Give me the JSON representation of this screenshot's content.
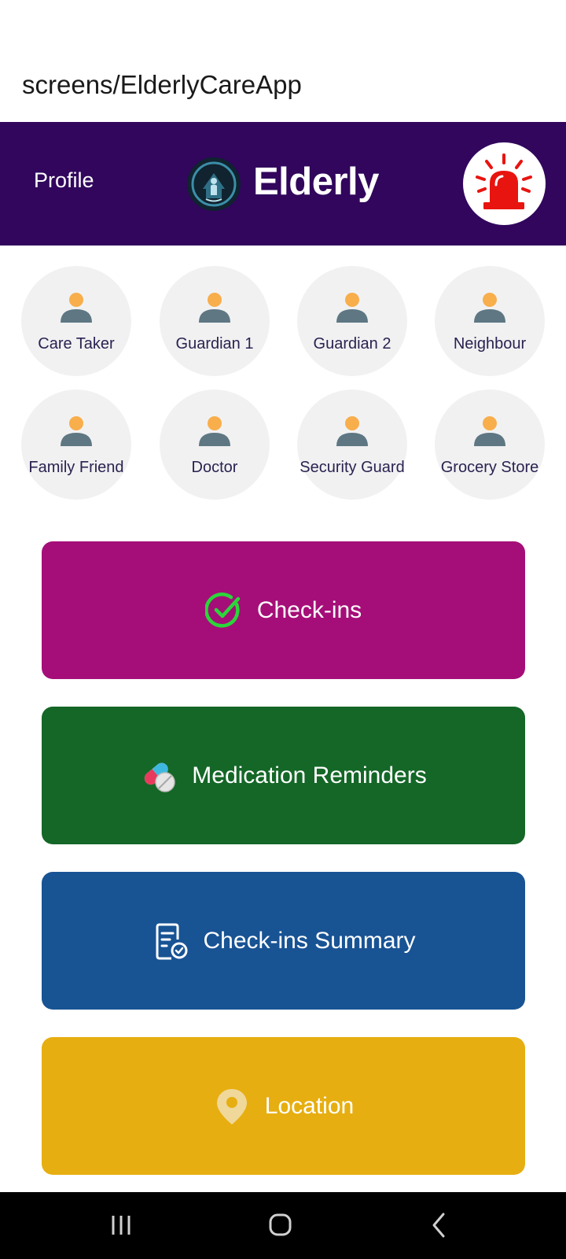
{
  "route_title": "screens/ElderlyCareApp",
  "header": {
    "profile_label": "Profile",
    "brand_title": "Elderly",
    "logo_icon": "elderly-logo-icon",
    "alarm_icon": "siren-alarm-icon",
    "background": "#31065c"
  },
  "contacts": [
    {
      "label": "Care Taker"
    },
    {
      "label": "Guardian 1"
    },
    {
      "label": "Guardian 2"
    },
    {
      "label": "Neighbour"
    },
    {
      "label": "Family Friend"
    },
    {
      "label": "Doctor"
    },
    {
      "label": "Security Guard"
    },
    {
      "label": "Grocery Store"
    }
  ],
  "actions": [
    {
      "label": "Check-ins",
      "icon": "check-circle-icon",
      "color": "#a50e78"
    },
    {
      "label": "Medication Reminders",
      "icon": "pills-icon",
      "color": "#146727"
    },
    {
      "label": "Check-ins Summary",
      "icon": "document-check-icon",
      "color": "#185394"
    },
    {
      "label": "Location",
      "icon": "map-pin-icon",
      "color": "#e6ae10"
    }
  ],
  "navbar": {
    "recents_icon": "recents-icon",
    "home_icon": "home-icon",
    "back_icon": "back-icon"
  }
}
